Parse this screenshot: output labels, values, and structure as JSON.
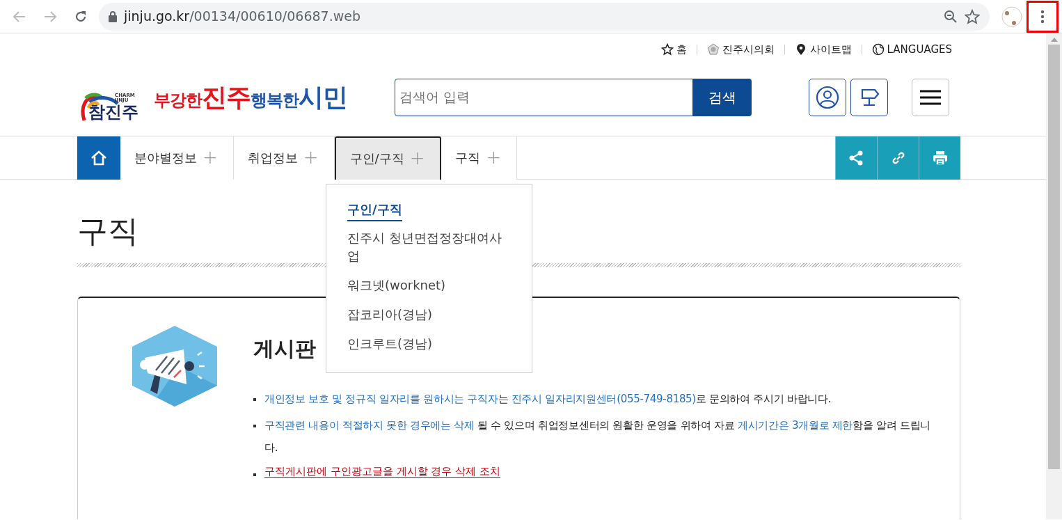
{
  "browser": {
    "url_host": "jinju.go.kr",
    "url_path": "/00134/00610/06687.web",
    "menu_highlighted": true
  },
  "utility_links": [
    {
      "kind": "home",
      "label": "홈"
    },
    {
      "kind": "council",
      "label": "진주시의회"
    },
    {
      "kind": "sitemap",
      "label": "사이트맵"
    },
    {
      "kind": "languages",
      "label": "LANGUAGES"
    }
  ],
  "logo": {
    "sub": "CHARM JINJU",
    "mark": "참진주",
    "slogan_parts": [
      {
        "text": "부강한",
        "color": "#e3141c",
        "large": false
      },
      {
        "text": "진주",
        "color": "#e3141c",
        "large": true
      },
      {
        "text": "행복한",
        "color": "#1f55a8",
        "large": false
      },
      {
        "text": "시민",
        "color": "#1f55a8",
        "large": true
      }
    ]
  },
  "search": {
    "placeholder": "검색어 입력",
    "button": "검색"
  },
  "nav": [
    {
      "label": "분야별정보",
      "selected": false
    },
    {
      "label": "취업정보",
      "selected": false
    },
    {
      "label": "구인/구직",
      "selected": true
    },
    {
      "label": "구직",
      "selected": false
    }
  ],
  "nav_plus": "+",
  "dropdown": [
    {
      "label": "구인/구직",
      "selected": true
    },
    {
      "label": "진주시 청년면접정장대여사업",
      "selected": false
    },
    {
      "label": "워크넷(worknet)",
      "selected": false
    },
    {
      "label": "잡코리아(경남)",
      "selected": false
    },
    {
      "label": "인크루트(경남)",
      "selected": false
    }
  ],
  "page_title": "구직",
  "board": {
    "title": "게시판",
    "notices": [
      {
        "kind": "info",
        "segments": [
          {
            "text": "개인정보 보호 및 정규직 일자리를 원하시는 구직자",
            "highlighted": true
          },
          {
            "text": "는 ",
            "highlighted": false
          },
          {
            "text": "진주시 일자리지원센터(055-749-8185)",
            "highlighted": true
          },
          {
            "text": "로 문의하여 주시기 바랍니다.",
            "highlighted": false
          }
        ]
      },
      {
        "kind": "info",
        "segments": [
          {
            "text": "구직관련 내용이 적절하지 못한 경우에는 삭제",
            "highlighted": true
          },
          {
            "text": " 될 수 있으며 취업정보센터의 원활한 운영을 위하여 자료 ",
            "highlighted": false
          },
          {
            "text": "게시기간은 3개월로 제한",
            "highlighted": true
          },
          {
            "text": "함을 알려 드립니다.",
            "highlighted": false
          }
        ]
      },
      {
        "kind": "warning-link",
        "segments": [
          {
            "text": "구직게시판에 구인광고글을 게시할 경우 삭제 조치",
            "highlighted": false
          }
        ]
      }
    ]
  }
}
